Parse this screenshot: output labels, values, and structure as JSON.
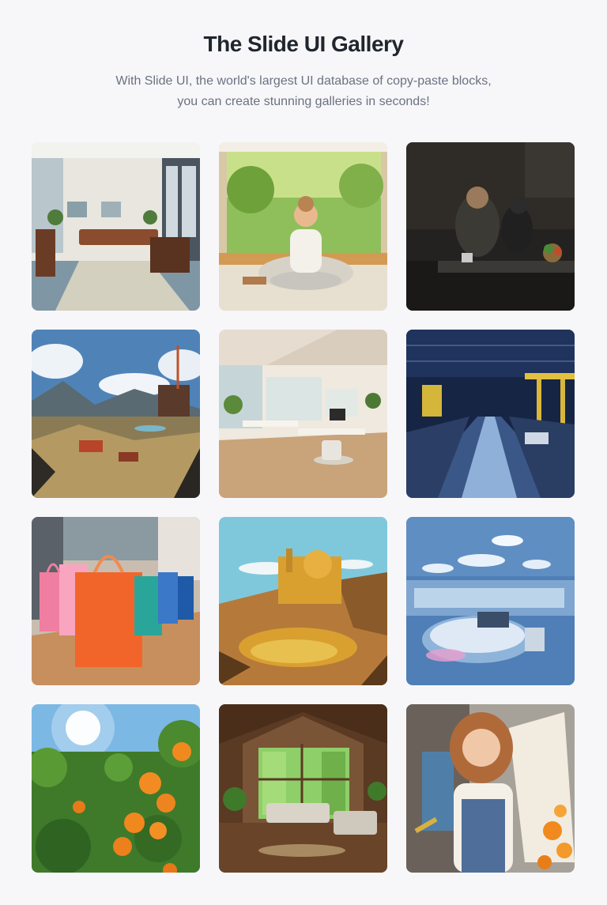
{
  "header": {
    "title": "The Slide UI Gallery",
    "subtitle_line1": "With Slide UI, the world's largest UI database of copy-paste blocks,",
    "subtitle_line2": "you can create stunning galleries in seconds!"
  },
  "gallery": {
    "images": [
      {
        "name": "office-lounge-image",
        "icon": "image"
      },
      {
        "name": "woman-meditating-image",
        "icon": "image"
      },
      {
        "name": "man-with-dog-image",
        "icon": "image"
      },
      {
        "name": "mining-landscape-image",
        "icon": "image"
      },
      {
        "name": "bright-office-image",
        "icon": "image"
      },
      {
        "name": "factory-conveyor-image",
        "icon": "image"
      },
      {
        "name": "shopping-bags-image",
        "icon": "image"
      },
      {
        "name": "golden-machine-image",
        "icon": "image"
      },
      {
        "name": "futuristic-lab-image",
        "icon": "image"
      },
      {
        "name": "orange-tree-image",
        "icon": "image"
      },
      {
        "name": "cozy-cabin-image",
        "icon": "image"
      },
      {
        "name": "painter-woman-image",
        "icon": "image"
      }
    ]
  },
  "colors": {
    "background": "#f7f7fa",
    "title": "#21262d",
    "subtitle": "#6b7280"
  }
}
